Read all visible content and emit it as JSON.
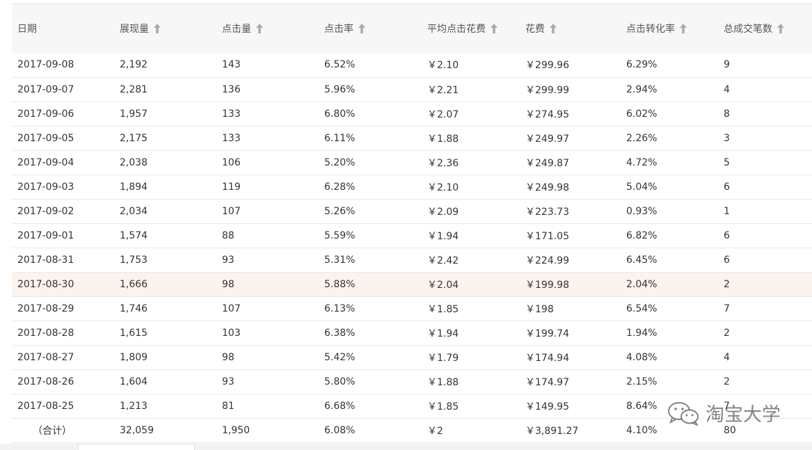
{
  "colors": {
    "header_bg": "#f7f7f7",
    "highlight_row": "#fbf3ec",
    "border": "#e8e8e8"
  },
  "table": {
    "columns": [
      {
        "label": "日期",
        "sortable": false
      },
      {
        "label": "展现量",
        "sortable": true
      },
      {
        "label": "点击量",
        "sortable": true
      },
      {
        "label": "点击率",
        "sortable": true
      },
      {
        "label": "平均点击花费",
        "sortable": true
      },
      {
        "label": "花费",
        "sortable": true
      },
      {
        "label": "点击转化率",
        "sortable": true
      },
      {
        "label": "总成交笔数",
        "sortable": true
      }
    ],
    "rows": [
      [
        "2017-09-08",
        "2,192",
        "143",
        "6.52%",
        "￥2.10",
        "￥299.96",
        "6.29%",
        "9"
      ],
      [
        "2017-09-07",
        "2,281",
        "136",
        "5.96%",
        "￥2.21",
        "￥299.99",
        "2.94%",
        "4"
      ],
      [
        "2017-09-06",
        "1,957",
        "133",
        "6.80%",
        "￥2.07",
        "￥274.95",
        "6.02%",
        "8"
      ],
      [
        "2017-09-05",
        "2,175",
        "133",
        "6.11%",
        "￥1.88",
        "￥249.97",
        "2.26%",
        "3"
      ],
      [
        "2017-09-04",
        "2,038",
        "106",
        "5.20%",
        "￥2.36",
        "￥249.87",
        "4.72%",
        "5"
      ],
      [
        "2017-09-03",
        "1,894",
        "119",
        "6.28%",
        "￥2.10",
        "￥249.98",
        "5.04%",
        "6"
      ],
      [
        "2017-09-02",
        "2,034",
        "107",
        "5.26%",
        "￥2.09",
        "￥223.73",
        "0.93%",
        "1"
      ],
      [
        "2017-09-01",
        "1,574",
        "88",
        "5.59%",
        "￥1.94",
        "￥171.05",
        "6.82%",
        "6"
      ],
      [
        "2017-08-31",
        "1,753",
        "93",
        "5.31%",
        "￥2.42",
        "￥224.99",
        "6.45%",
        "6"
      ],
      [
        "2017-08-30",
        "1,666",
        "98",
        "5.88%",
        "￥2.04",
        "￥199.98",
        "2.04%",
        "2"
      ],
      [
        "2017-08-29",
        "1,746",
        "107",
        "6.13%",
        "￥1.85",
        "￥198",
        "6.54%",
        "7"
      ],
      [
        "2017-08-28",
        "1,615",
        "103",
        "6.38%",
        "￥1.94",
        "￥199.74",
        "1.94%",
        "2"
      ],
      [
        "2017-08-27",
        "1,809",
        "98",
        "5.42%",
        "￥1.79",
        "￥174.94",
        "4.08%",
        "4"
      ],
      [
        "2017-08-26",
        "1,604",
        "93",
        "5.80%",
        "￥1.88",
        "￥174.97",
        "2.15%",
        "2"
      ],
      [
        "2017-08-25",
        "1,213",
        "81",
        "6.68%",
        "￥1.85",
        "￥149.95",
        "8.64%",
        "7"
      ]
    ],
    "highlighted_row": 9,
    "total": [
      "（合计）",
      "32,059",
      "1,950",
      "6.08%",
      "￥2",
      "￥3,891.27",
      "4.10%",
      "80"
    ]
  },
  "watermark": {
    "text": "淘宝大学",
    "icon": "wechat-icon"
  }
}
